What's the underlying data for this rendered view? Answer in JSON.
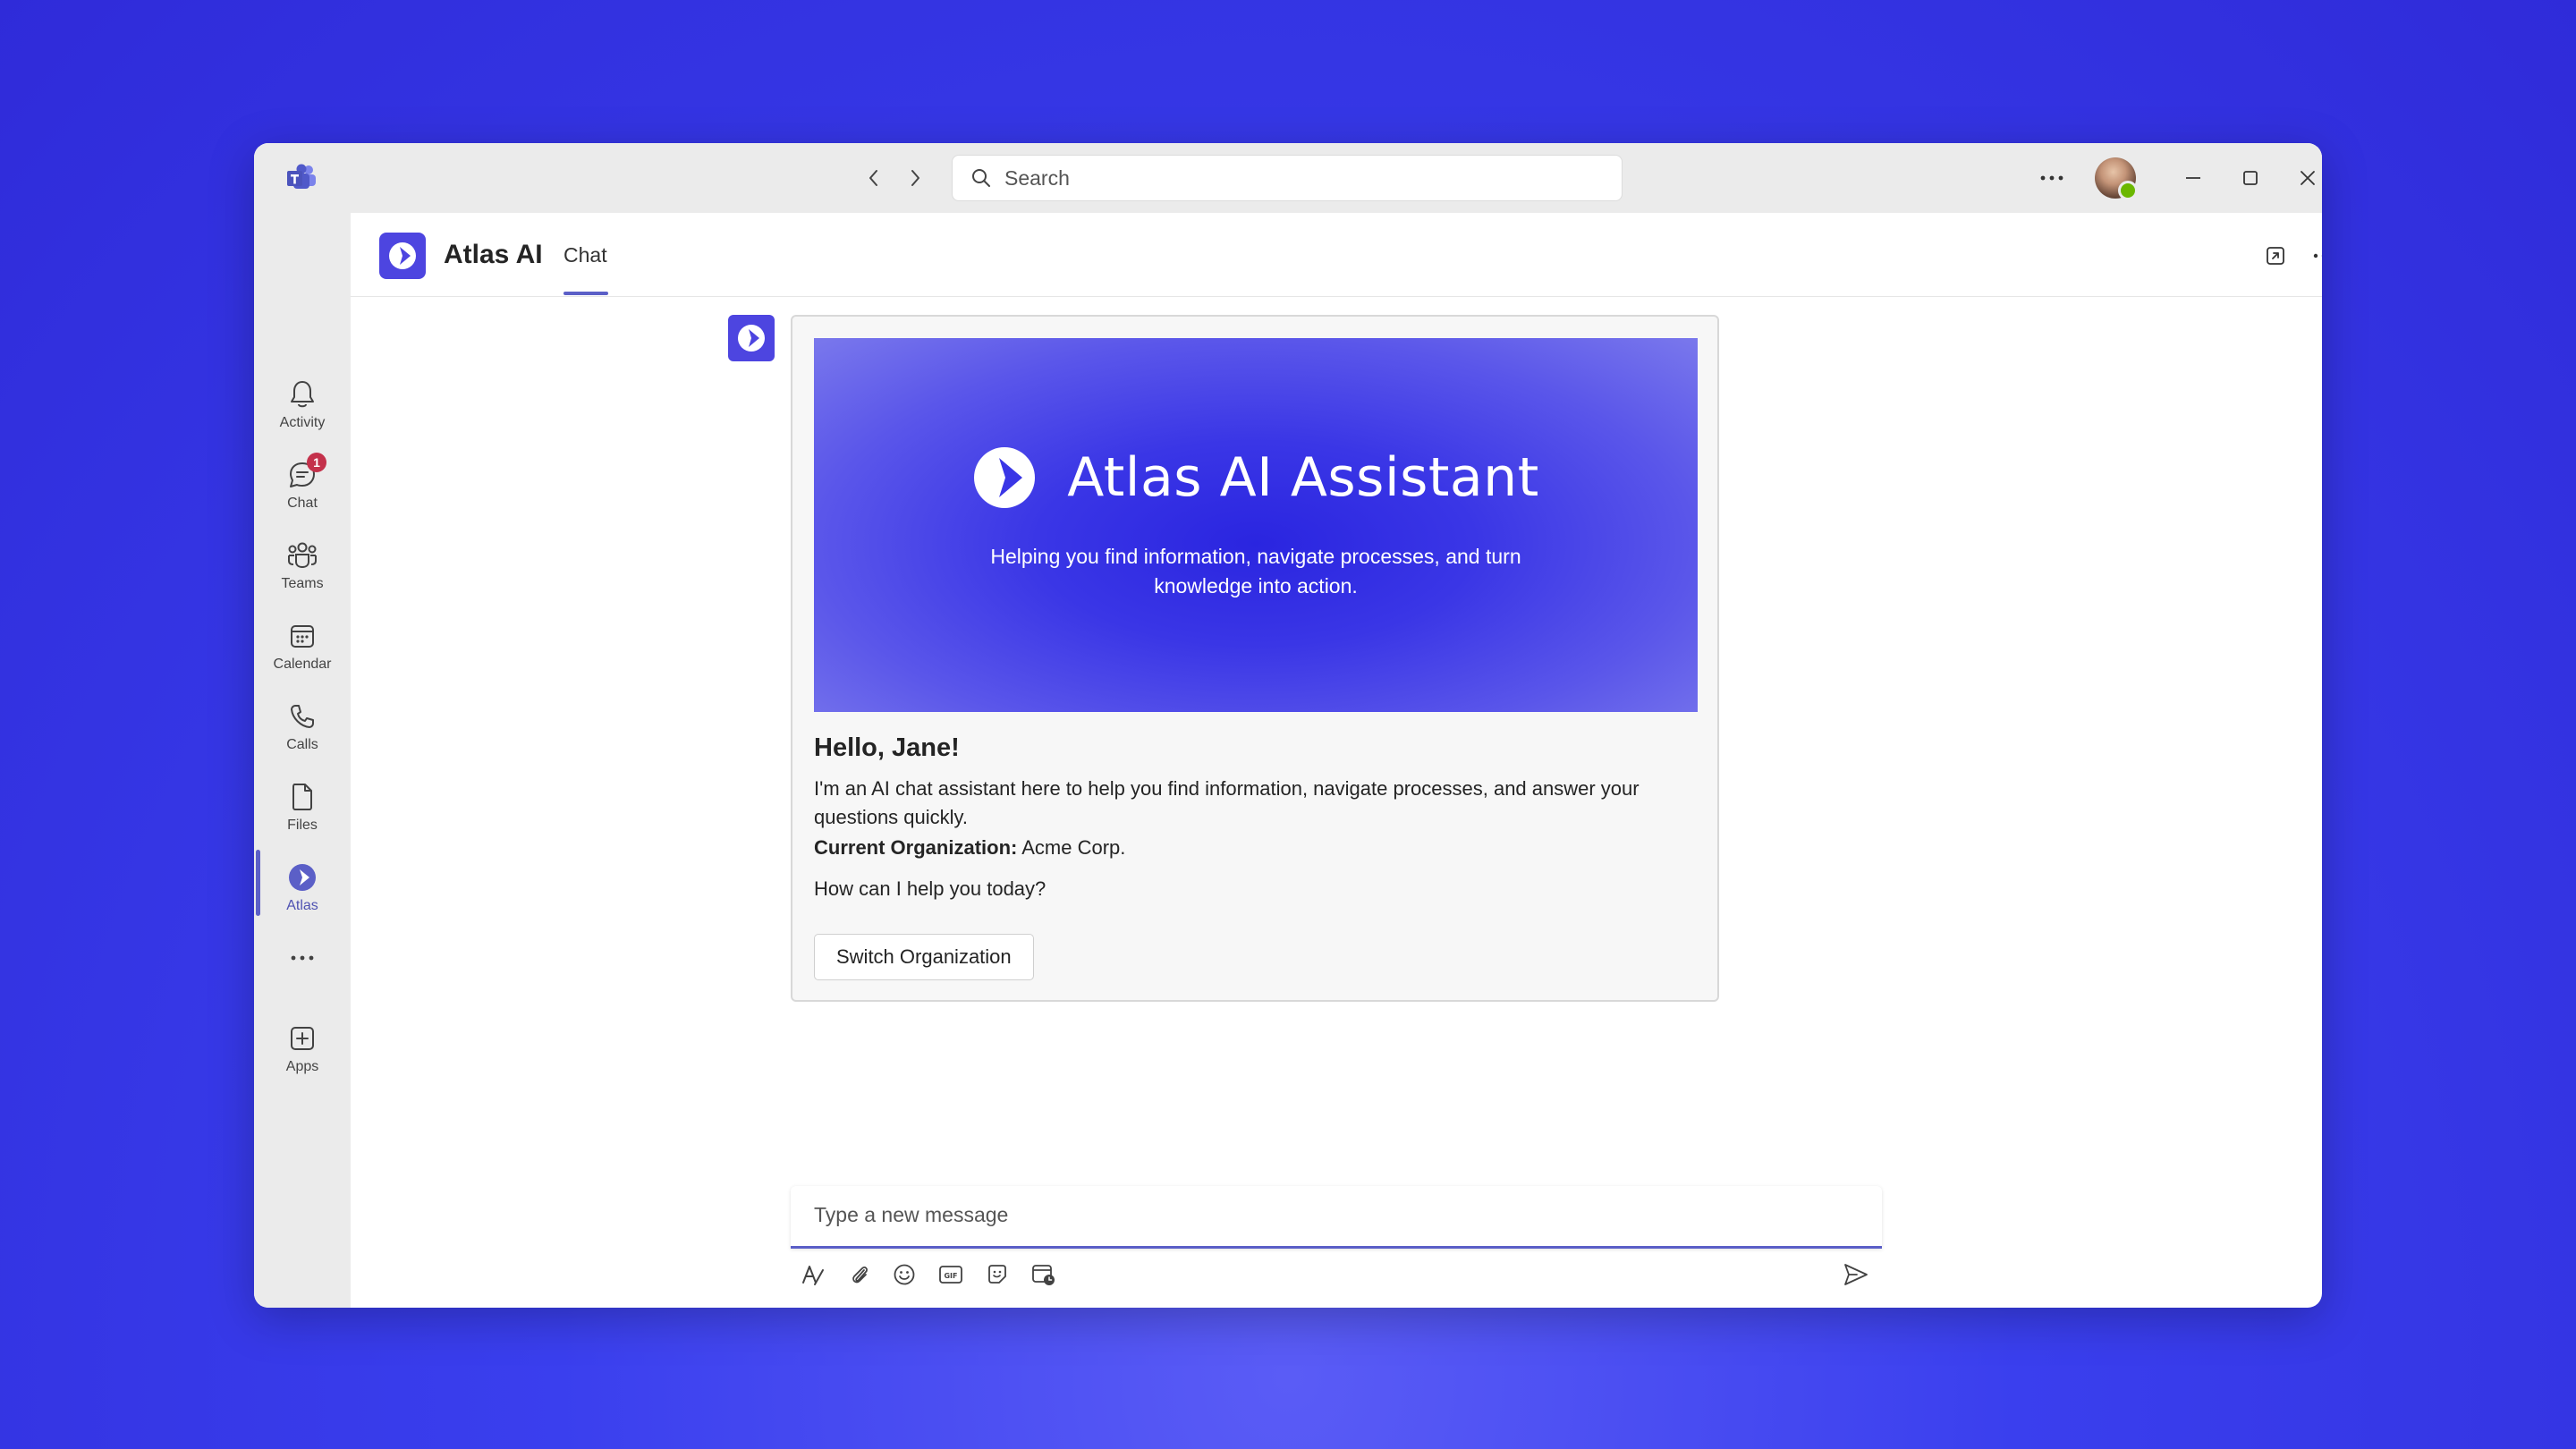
{
  "window": {
    "search": {
      "placeholder": "Search"
    }
  },
  "rail": {
    "items": [
      {
        "label": "Activity",
        "icon": "bell-icon"
      },
      {
        "label": "Chat",
        "icon": "chat-icon",
        "badge": "1"
      },
      {
        "label": "Teams",
        "icon": "teams-icon"
      },
      {
        "label": "Calendar",
        "icon": "calendar-icon"
      },
      {
        "label": "Calls",
        "icon": "phone-icon"
      },
      {
        "label": "Files",
        "icon": "file-icon"
      },
      {
        "label": "Atlas",
        "icon": "atlas-icon",
        "active": true
      },
      {
        "label": "",
        "icon": "more-icon"
      },
      {
        "label": "Apps",
        "icon": "apps-icon"
      }
    ]
  },
  "header": {
    "app_name": "Atlas AI",
    "tab": "Chat"
  },
  "card": {
    "hero_title": "Atlas AI Assistant",
    "hero_subtitle": "Helping you find information, navigate processes, and turn knowledge into action.",
    "greeting": "Hello, Jane!",
    "intro": "I'm an AI chat assistant here to help you find information, navigate processes, and answer your questions quickly.",
    "org_label": "Current Organization:",
    "org_value": "Acme Corp.",
    "prompt": "How can I help you today?",
    "button": "Switch Organization"
  },
  "composer": {
    "placeholder": "Type a new message"
  },
  "colors": {
    "accent": "#5b5fc7",
    "brand": "#4d45e0",
    "badge": "#c4314b",
    "presence": "#6bb700"
  }
}
